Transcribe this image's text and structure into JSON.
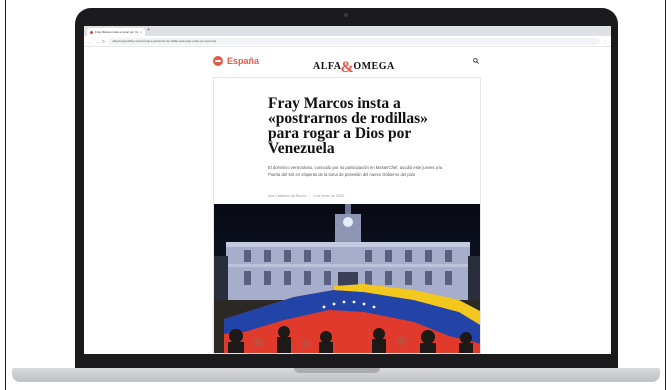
{
  "browser": {
    "tab_title": "Fray Marcos insta a rezar por Venezuela",
    "tab_close": "×",
    "tab_new": "+",
    "url": "alfayomega.es/fray-marcos-insta-a-postrarnos-de-rodillas-para-rogar-a-dios-por-venezuela",
    "back_icon": "←",
    "forward_icon": "→",
    "reload_icon": "↻",
    "menu_icon": "⋮"
  },
  "site": {
    "section": "España",
    "logo_left": "ALFA",
    "logo_amp": "&",
    "logo_right": "OMEGA",
    "accent_color": "#e05a47"
  },
  "article": {
    "headline": "Fray Marcos insta a «postrarnos de rodillas» para rogar a Dios por Venezuela",
    "standfirst": "El dominico venezolano, conocido por su participación en MasterChef, acudió este jueves a la Puerta del Sol en vísperas de la toma de posesión del nuevo Gobierno del país",
    "author": "Ana Celestino de Rincón",
    "date": "9 de enero de 2025"
  }
}
